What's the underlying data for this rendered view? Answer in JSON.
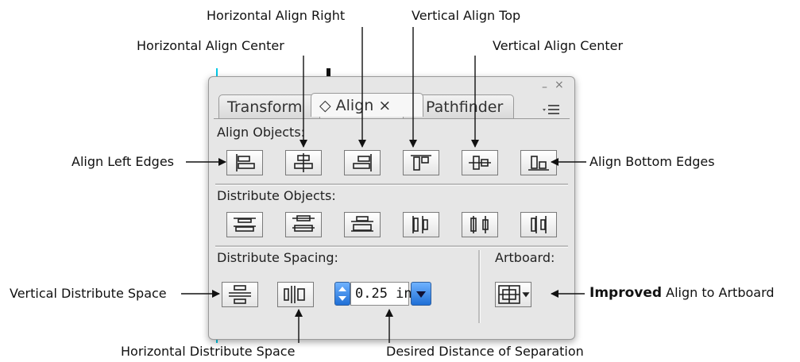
{
  "callouts": {
    "h_align_right": "Horizontal Align Right",
    "v_align_top": "Vertical Align Top",
    "h_align_center": "Horizontal Align Center",
    "v_align_center": "Vertical Align Center",
    "align_left": "Align Left Edges",
    "align_bottom": "Align Bottom Edges",
    "v_distribute_space": "Vertical Distribute Space",
    "improved_bold": "Improved",
    "align_to_artboard": " Align to Artboard",
    "h_distribute_space": "Horizontal Distribute Space",
    "desired_distance": "Desired Distance of Separation"
  },
  "panel": {
    "tabs": [
      {
        "label": "Transform"
      },
      {
        "label": "◇ Align ×"
      },
      {
        "label": "Pathfinder"
      }
    ],
    "minimize": "–",
    "close": "×",
    "menu_icon": "panel-menu-icon",
    "align_objects_label": "Align Objects:",
    "distribute_objects_label": "Distribute Objects:",
    "distribute_spacing_label": "Distribute Spacing:",
    "artboard_label": "Artboard:",
    "spacing_value": "0.25 in"
  },
  "colors": {
    "accent_blue": "#1f6fd6",
    "guide_cyan": "#00c8e6"
  }
}
